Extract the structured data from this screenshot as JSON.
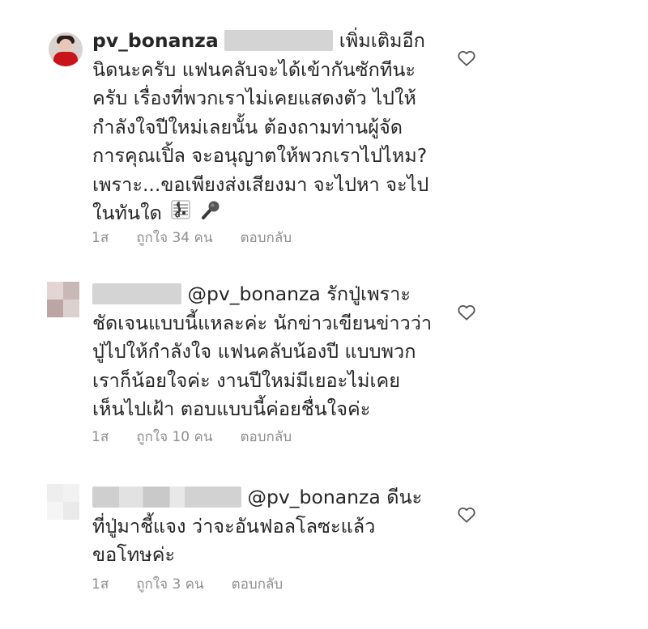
{
  "comments": [
    {
      "username": "pv_bonanza",
      "lines": [
        "เพิ่มเติมอีก",
        "นิดนะครับ แฟนคลับจะได้เข้ากันซักทีนะ",
        "ครับ เรื่องที่พวกเราไม่เคยแสดงตัว ไปให้",
        "กำลังใจปีใหม่เลยนั้น ต้องถามท่านผู้จัด",
        "การคุณเปิ้ล จะอนุญาตให้พวกเราไปไหม?",
        "เพราะ...ขอเพียงส่งเสียงมา จะไปหา จะไป",
        "ในทันใด"
      ],
      "emoji": [
        "music-score",
        "microphone"
      ],
      "time": "1ส",
      "likes": "ถูกใจ 34 คน",
      "reply": "ตอบกลับ"
    },
    {
      "mention": "@pv_bonanza",
      "lines": [
        "รักปู่เพราะ",
        "ชัดเจนแบบนี้แหละค่ะ นักข่าวเขียนข่าวว่า",
        "ปู่ไปให้กำลังใจ แฟนคลับน้องปี แบบพวก",
        "เราก็น้อยใจค่ะ งานปีใหม่มีเยอะไม่เคย",
        "เห็นไปเฝ้า ตอบแบบนี้ค่อยชื่นใจค่ะ"
      ],
      "time": "1ส",
      "likes": "ถูกใจ 10 คน",
      "reply": "ตอบกลับ"
    },
    {
      "mention": "@pv_bonanza",
      "lines": [
        "ดีนะ",
        "ที่ปู่มาชี้แจง ว่าจะอันฟอลโลซะแล้ว",
        "ขอโทษค่ะ"
      ],
      "time": "1ส",
      "likes": "ถูกใจ 3 คน",
      "reply": "ตอบกลับ"
    }
  ],
  "icons": {
    "like": "heart-outline-icon"
  },
  "colors": {
    "text": "#262626",
    "meta": "#8e8e8e"
  }
}
